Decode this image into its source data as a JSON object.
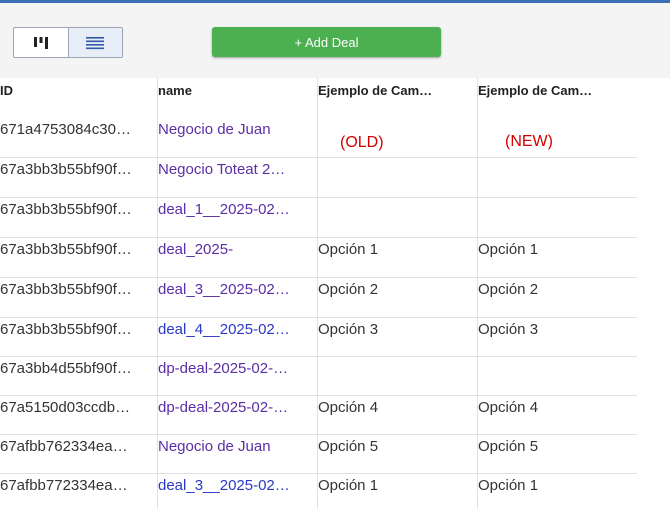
{
  "toolbar": {
    "add_deal_label": "+ Add Deal"
  },
  "table": {
    "columns": {
      "id": "ID",
      "name": "name",
      "old_field": "Ejemplo de Cam…",
      "new_field": "Ejemplo de Cam…"
    },
    "annotations": {
      "old": "(OLD)",
      "new": "(NEW)"
    },
    "rows": [
      {
        "id": "671a4753084c30…",
        "name": "Negocio de Juan",
        "old": "",
        "new": ""
      },
      {
        "id": "67a3bb3b55bf90f…",
        "name": "Negocio Toteat 2…",
        "old": "",
        "new": ""
      },
      {
        "id": "67a3bb3b55bf90f…",
        "name": "deal_1__2025-02…",
        "old": "",
        "new": ""
      },
      {
        "id": "67a3bb3b55bf90f…",
        "name": "deal_2025-",
        "old": "Opción 1",
        "new": "Opción 1"
      },
      {
        "id": "67a3bb3b55bf90f…",
        "name": "deal_3__2025-02…",
        "old": "Opción 2",
        "new": "Opción 2"
      },
      {
        "id": "67a3bb3b55bf90f…",
        "name": "deal_4__2025-02…",
        "old": "Opción 3",
        "new": "Opción 3"
      },
      {
        "id": "67a3bb4d55bf90f…",
        "name": "dp-deal-2025-02-…",
        "old": "",
        "new": ""
      },
      {
        "id": "67a5150d03ccdb…",
        "name": "dp-deal-2025-02-…",
        "old": "Opción 4",
        "new": "Opción 4"
      },
      {
        "id": "67afbb762334ea…",
        "name": "Negocio de Juan",
        "old": "Opción 5",
        "new": "Opción 5"
      },
      {
        "id": "67afbb772334ea…",
        "name": "deal_3__2025-02…",
        "old": "Opción 1",
        "new": "Opción 1"
      }
    ]
  }
}
